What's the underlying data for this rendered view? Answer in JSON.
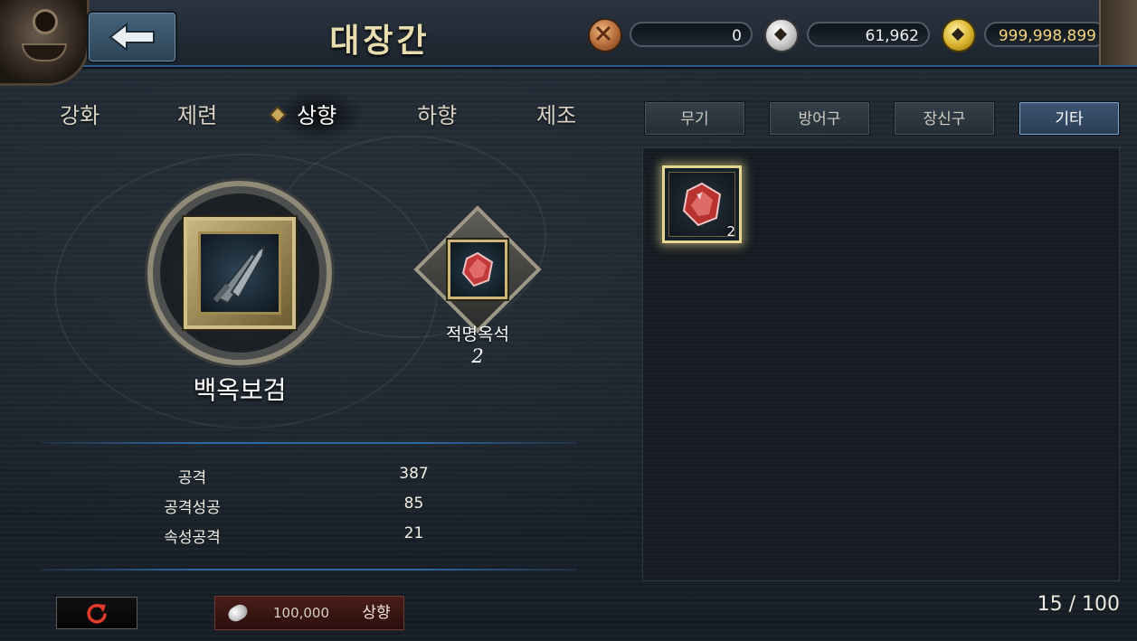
{
  "header": {
    "title": "대장간",
    "currencies": [
      {
        "name": "bronze-coin",
        "value": "0",
        "color": "#b36a37"
      },
      {
        "name": "silver-coin",
        "value": "61,962",
        "color": "#c7c7c7"
      },
      {
        "name": "gold-coin",
        "value": "999,998,899",
        "color": "#d8b02a"
      }
    ]
  },
  "tabs": [
    {
      "label": "강화",
      "active": false
    },
    {
      "label": "제련",
      "active": false
    },
    {
      "label": "상향",
      "active": true
    },
    {
      "label": "하향",
      "active": false
    },
    {
      "label": "제조",
      "active": false
    }
  ],
  "categories": [
    {
      "label": "무기",
      "active": false
    },
    {
      "label": "방어구",
      "active": false
    },
    {
      "label": "장신구",
      "active": false
    },
    {
      "label": "기타",
      "active": true
    }
  ],
  "weapon": {
    "name": "백옥보검"
  },
  "material": {
    "name": "적명옥석",
    "count": "2"
  },
  "stats": [
    {
      "label": "공격",
      "value": "387"
    },
    {
      "label": "공격성공",
      "value": "85"
    },
    {
      "label": "속성공격",
      "value": "21"
    }
  ],
  "inventory": {
    "items": [
      {
        "icon": "red-gem-icon",
        "count": "2",
        "selected": true
      }
    ],
    "capacity": "15 / 100"
  },
  "actions": {
    "upgrade_cost": "100,000",
    "upgrade_label": "상향"
  }
}
